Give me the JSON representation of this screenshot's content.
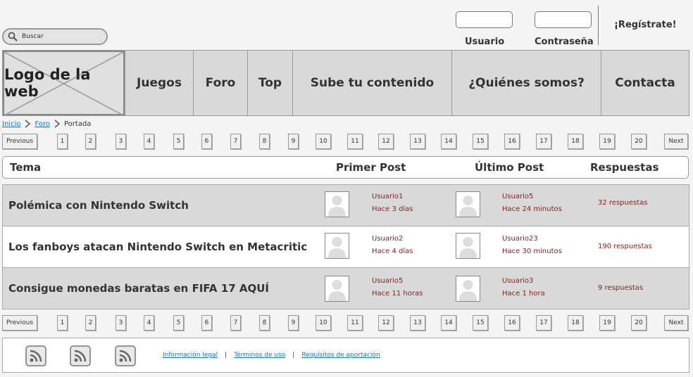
{
  "search": {
    "placeholder": "Buscar"
  },
  "login": {
    "user_label": "Usuario",
    "password_label": "Contraseña",
    "register_label": "¡Regístrate!"
  },
  "nav": {
    "logo": "Logo de la web",
    "items": [
      "Juegos",
      "Foro",
      "Top",
      "Sube tu contenido",
      "¿Quiénes somos?",
      "Contacta"
    ]
  },
  "breadcrumb": {
    "items": [
      "Inicio",
      "Foro"
    ],
    "current": "Portada"
  },
  "pagination": {
    "previous": "Previous",
    "next": "Next",
    "pages": [
      "1",
      "2",
      "3",
      "4",
      "5",
      "6",
      "7",
      "8",
      "9",
      "10",
      "11",
      "12",
      "13",
      "14",
      "15",
      "16",
      "17",
      "18",
      "19",
      "20"
    ]
  },
  "table": {
    "headers": {
      "topic": "Tema",
      "first": "Primer Post",
      "last": "Último Post",
      "replies": "Respuestas"
    },
    "rows": [
      {
        "topic": "Polémica con Nintendo Switch",
        "first_user": "Usuario1",
        "first_time": "Hace 3 días",
        "last_user": "Usuario5",
        "last_time": "Hace 24 minutos",
        "replies": "32 respuestas"
      },
      {
        "topic": "Los fanboys atacan Nintendo Switch en Metacritic",
        "first_user": "Usuario2",
        "first_time": "Hace 4 días",
        "last_user": "Usuario23",
        "last_time": "Hace 30 minutos",
        "replies": "190 respuestas"
      },
      {
        "topic": "Consigue monedas baratas en FIFA 17 AQUÍ",
        "first_user": "Usuario5",
        "first_time": "Hace 11 horas",
        "last_user": "Usuario3",
        "last_time": "Hace 1 hora",
        "replies": "9 respuestas"
      }
    ]
  },
  "footer": {
    "links": [
      "Información legal",
      "Términos de uso",
      "Requisitos de aportación"
    ],
    "separator": "|"
  },
  "colors": {
    "link": "#1e6fc8",
    "user_text": "#8a1c1c",
    "nav_bg": "#d9d9d9"
  },
  "icons": [
    "search-icon",
    "chevron-right-icon",
    "avatar-placeholder-icon",
    "rss-icon"
  ]
}
